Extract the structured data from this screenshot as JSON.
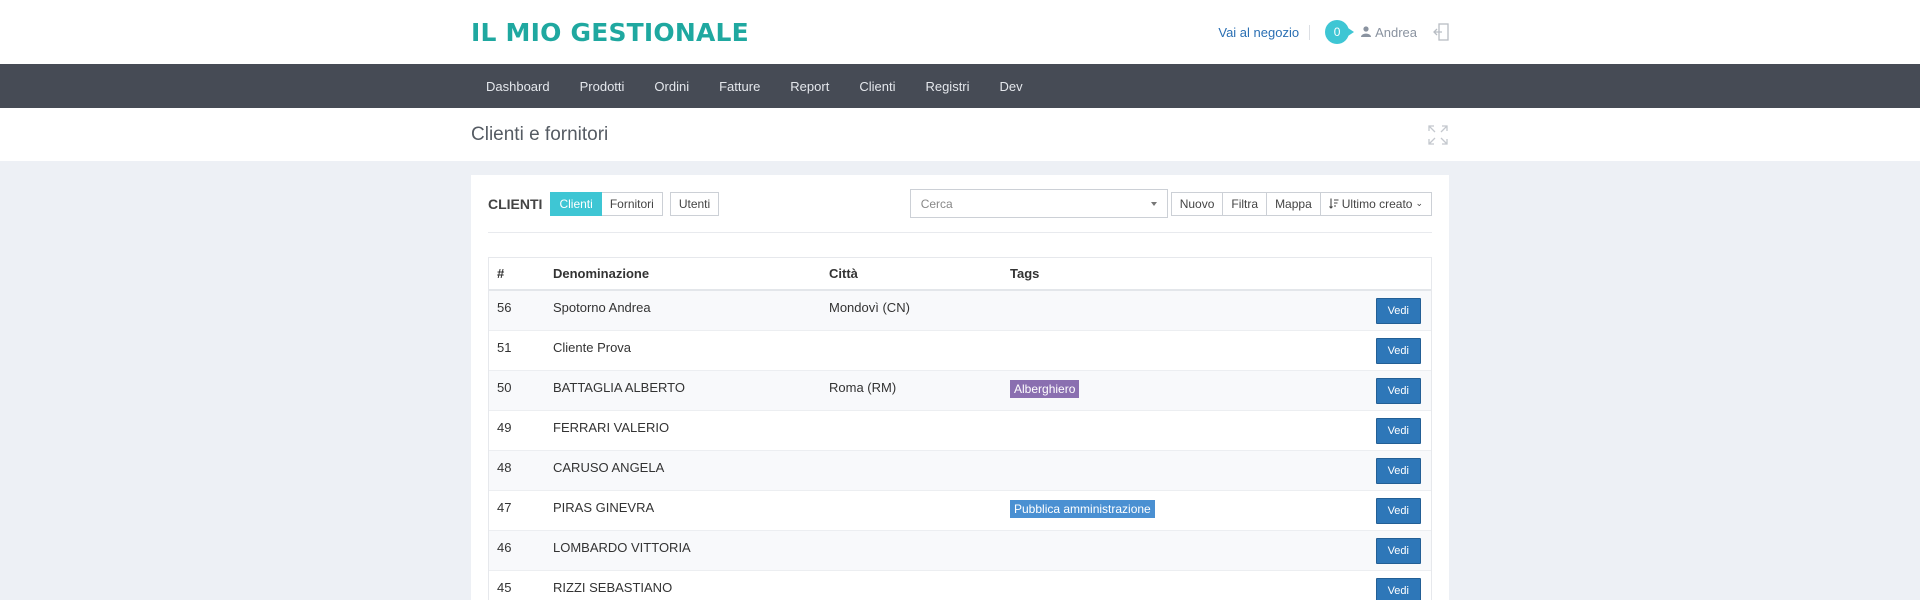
{
  "header": {
    "logo": "IL MIO GESTIONALE",
    "shop_link": "Vai al negozio",
    "notifications": "0",
    "user": "Andrea",
    "icons": {
      "user": "user-icon",
      "logout": "logout-icon"
    }
  },
  "nav": {
    "items": [
      "Dashboard",
      "Prodotti",
      "Ordini",
      "Fatture",
      "Report",
      "Clienti",
      "Registri",
      "Dev"
    ]
  },
  "page": {
    "title": "Clienti e fornitori",
    "expand_icon": "expand-icon"
  },
  "toolbar": {
    "section": "CLIENTI",
    "tabs": [
      "Clienti",
      "Fornitori"
    ],
    "users_button": "Utenti",
    "search_placeholder": "Cerca",
    "actions": [
      "Nuovo",
      "Filtra",
      "Mappa"
    ],
    "sort_label": "Ultimo creato"
  },
  "table": {
    "headers": [
      "#",
      "Denominazione",
      "Città",
      "Tags",
      ""
    ],
    "action_label": "Vedi",
    "rows": [
      {
        "id": "56",
        "name": "Spotorno Andrea",
        "city": "Mondovì (CN)",
        "tag": ""
      },
      {
        "id": "51",
        "name": "Cliente Prova",
        "city": "",
        "tag": ""
      },
      {
        "id": "50",
        "name": "BATTAGLIA ALBERTO",
        "city": "Roma (RM)",
        "tag": "Alberghiero"
      },
      {
        "id": "49",
        "name": "FERRARI VALERIO",
        "city": "",
        "tag": ""
      },
      {
        "id": "48",
        "name": "CARUSO ANGELA",
        "city": "",
        "tag": ""
      },
      {
        "id": "47",
        "name": "PIRAS GINEVRA",
        "city": "",
        "tag": "Pubblica amministrazione"
      },
      {
        "id": "46",
        "name": "LOMBARDO VITTORIA",
        "city": "",
        "tag": ""
      },
      {
        "id": "45",
        "name": "RIZZI SEBASTIANO",
        "city": "",
        "tag": ""
      }
    ]
  },
  "colors": {
    "brand": "#1fa8a0",
    "nav_bg": "#464b55",
    "active_tab": "#3ec6d4",
    "button_primary": "#2e77b8",
    "tag_alberghiero": "#8a6fb0",
    "tag_pubblica": "#4a90d2"
  }
}
